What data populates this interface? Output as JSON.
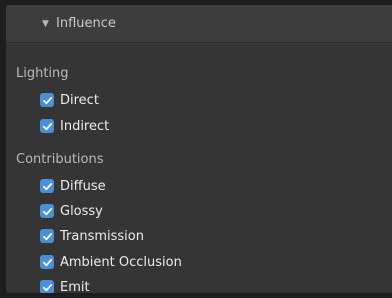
{
  "panel": {
    "title": "Influence",
    "expanded": true
  },
  "sections": [
    {
      "label": "Lighting",
      "items": [
        {
          "label": "Direct",
          "checked": true
        },
        {
          "label": "Indirect",
          "checked": true
        }
      ]
    },
    {
      "label": "Contributions",
      "items": [
        {
          "label": "Diffuse",
          "checked": true
        },
        {
          "label": "Glossy",
          "checked": true
        },
        {
          "label": "Transmission",
          "checked": true
        },
        {
          "label": "Ambient Occlusion",
          "checked": true
        },
        {
          "label": "Emit",
          "checked": true
        }
      ]
    }
  ],
  "colors": {
    "accent": "#4a90d9",
    "panel_bg": "#353535",
    "header_bg": "#3d3d3d"
  },
  "icons": {
    "collapse": "triangle-down-icon",
    "check": "checkmark-icon"
  }
}
